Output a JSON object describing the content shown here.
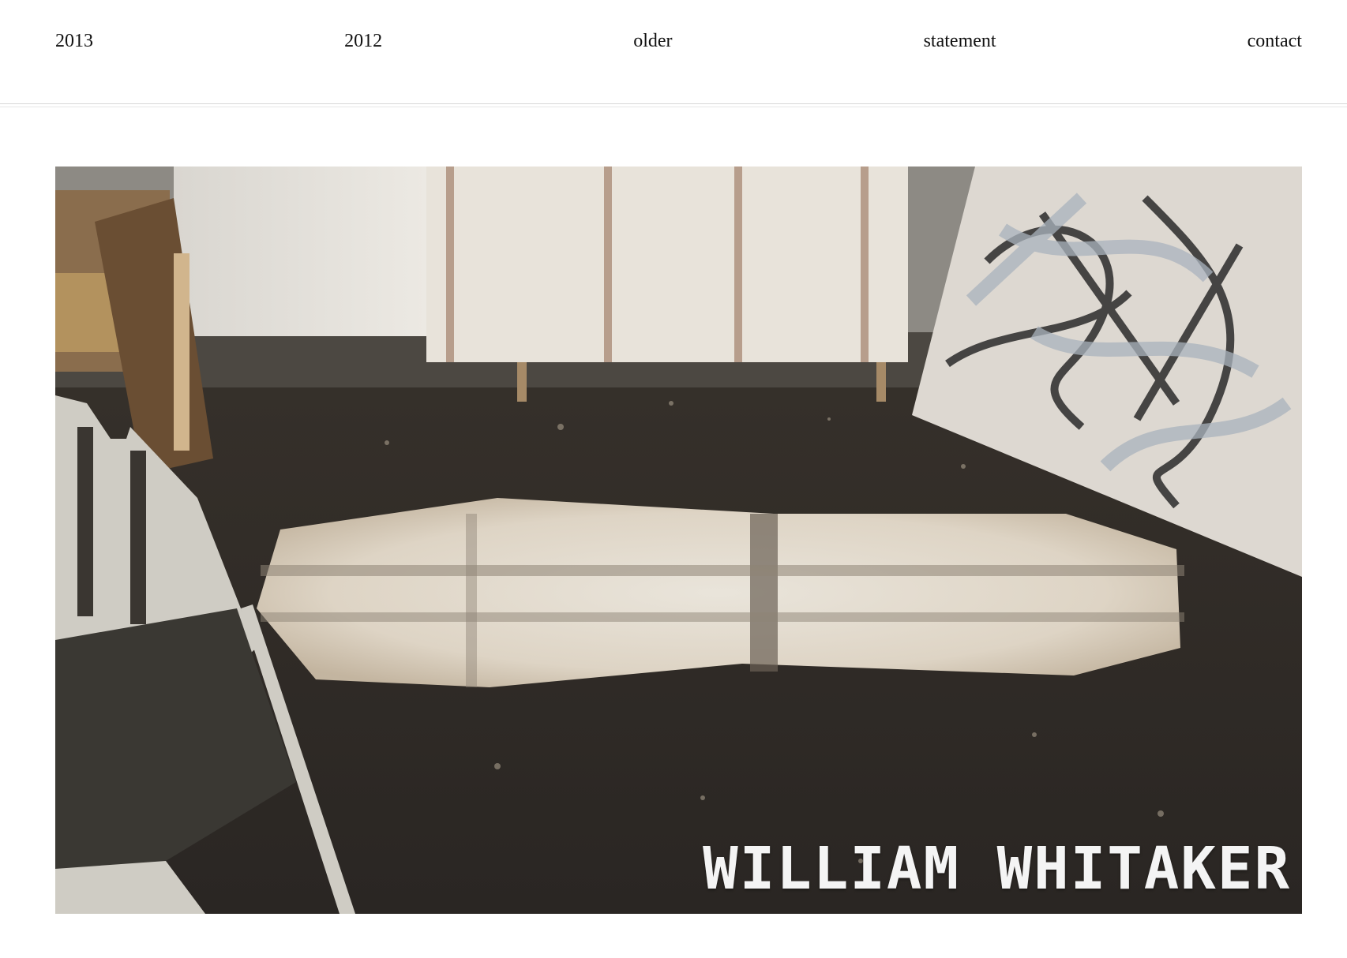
{
  "nav": {
    "items": [
      {
        "label": "2013"
      },
      {
        "label": "2012"
      },
      {
        "label": "older"
      },
      {
        "label": "statement"
      },
      {
        "label": "contact"
      }
    ]
  },
  "hero": {
    "title": "WILLIAM WHITAKER"
  }
}
